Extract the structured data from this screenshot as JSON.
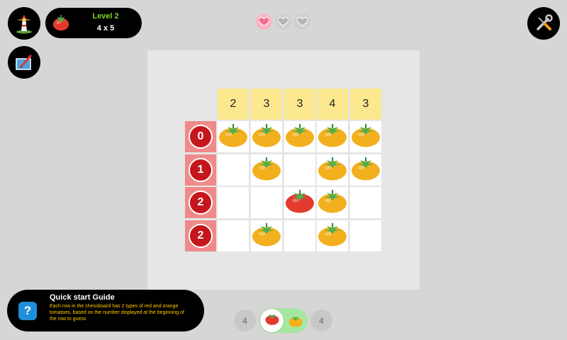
{
  "top": {
    "home_icon": "lighthouse-icon",
    "edit_icon": "pencil-board-icon",
    "settings_icon": "wrench-screwdriver-icon",
    "level_title": "Level 2",
    "level_size": "4 x 5",
    "hearts": [
      "full",
      "empty",
      "empty"
    ]
  },
  "board": {
    "column_counts": [
      "2",
      "3",
      "3",
      "4",
      "3"
    ],
    "row_counts": [
      "0",
      "1",
      "2",
      "2"
    ],
    "cells": [
      [
        "orange",
        "orange",
        "orange",
        "orange",
        "orange"
      ],
      [
        "empty",
        "orange",
        "empty",
        "orange",
        "orange"
      ],
      [
        "empty",
        "empty",
        "red",
        "orange",
        "empty"
      ],
      [
        "empty",
        "orange",
        "empty",
        "orange",
        "empty"
      ]
    ],
    "colors": {
      "red_tomato": "#e23b2e",
      "orange_tomato": "#f2b01e",
      "row_badge": "#c4161c",
      "column_header": "#fbe88f"
    }
  },
  "guide": {
    "title": "Quick start Guide",
    "text": "Each row in the chessboard has 2 types of red and orange tomatoes, based on the number displayed at the beginning of the row to guess"
  },
  "selector": {
    "red_count": "4",
    "orange_count": "4",
    "selected": "red"
  }
}
